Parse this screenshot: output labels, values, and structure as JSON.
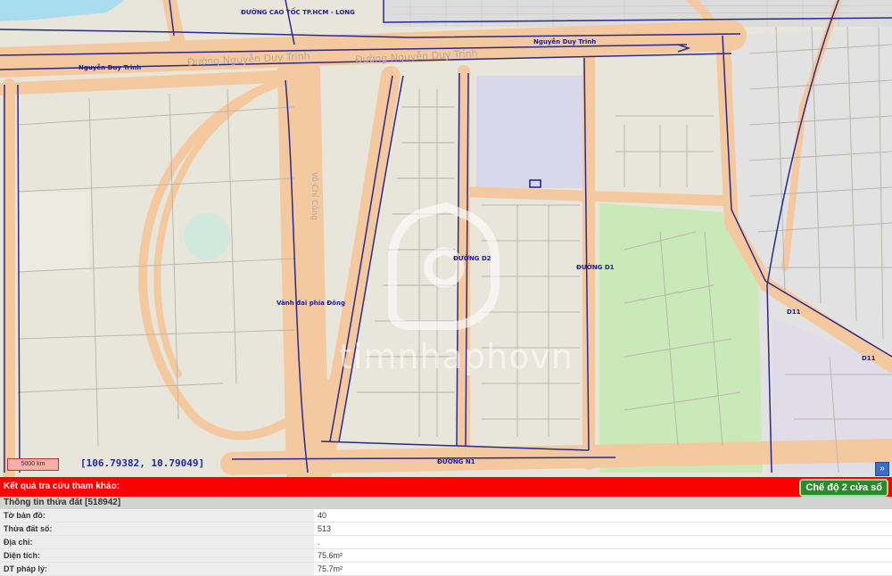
{
  "map": {
    "roads": {
      "highway": "ĐƯỜNG CAO TỐC TP.HCM - LONG",
      "nguyen_duy_trinh_right": "Nguyễn Duy Trinh",
      "nguyen_duy_trinh_left": "Nguyễn Duy Trinh",
      "nguyen_duy_trinh_gray_left": "Đường Nguyễn Duy Trinh",
      "nguyen_duy_trinh_gray_mid": "Đường Nguyễn Duy Trinh",
      "vanh_dai": "Vành đai phía Đông",
      "vo_chi_cong": "Võ Chí Công",
      "duong_d2": "ĐƯỜNG D2",
      "duong_d1": "ĐƯỜNG D1",
      "duong_n1": "ĐƯỜNG N1",
      "d11_a": "D11",
      "d11_b": "D11"
    },
    "coordinates": "[106.79382, 10.79049]",
    "scale": "5000 km",
    "watermark": "timnhaphovn",
    "expand_icon": "»"
  },
  "result": {
    "title": "Kết quả tra cứu tham khảo:",
    "mode_button": "Chế độ 2 cửa sổ",
    "section": "Thông tin thửa đất [518942]",
    "rows": [
      {
        "label": "Tờ bản đồ:",
        "value": "40"
      },
      {
        "label": "Thửa đất số:",
        "value": "513"
      },
      {
        "label": "Địa chỉ:",
        "value": "."
      },
      {
        "label": "Diện tích:",
        "value": "75.6m²"
      },
      {
        "label": "DT pháp lý:",
        "value": "75.7m²"
      }
    ]
  }
}
